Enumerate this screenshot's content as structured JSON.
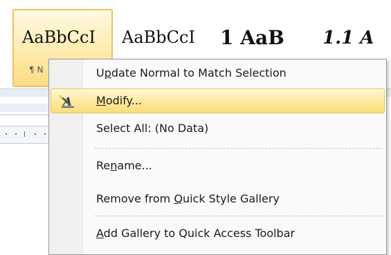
{
  "gallery": {
    "styles": [
      {
        "sample": "AaBbCcI",
        "caption": "¶ N"
      },
      {
        "sample": "AaBbCcI"
      },
      {
        "sample": "1  AaB"
      },
      {
        "sample": "1.1  A"
      }
    ]
  },
  "context_menu": {
    "items": [
      {
        "label_pre": "U",
        "label_ul": "p",
        "label_post": "date Normal to Match Selection"
      },
      {
        "label_pre": "",
        "label_ul": "M",
        "label_post": "odify...",
        "icon": "modify-style-icon",
        "highlighted": true
      },
      {
        "label_pre": "Select All: (No Data)",
        "label_ul": "",
        "label_post": ""
      },
      {
        "label_pre": "Re",
        "label_ul": "n",
        "label_post": "ame..."
      },
      {
        "label_pre": "Remove from ",
        "label_ul": "Q",
        "label_post": "uick Style Gallery"
      },
      {
        "label_pre": "",
        "label_ul": "A",
        "label_post": "dd Gallery to Quick Access Toolbar"
      }
    ]
  },
  "colors": {
    "highlight_fill": "#fde99a",
    "highlight_border": "#e8c55a",
    "menu_background": "#fafafa",
    "menu_border": "#979797"
  }
}
